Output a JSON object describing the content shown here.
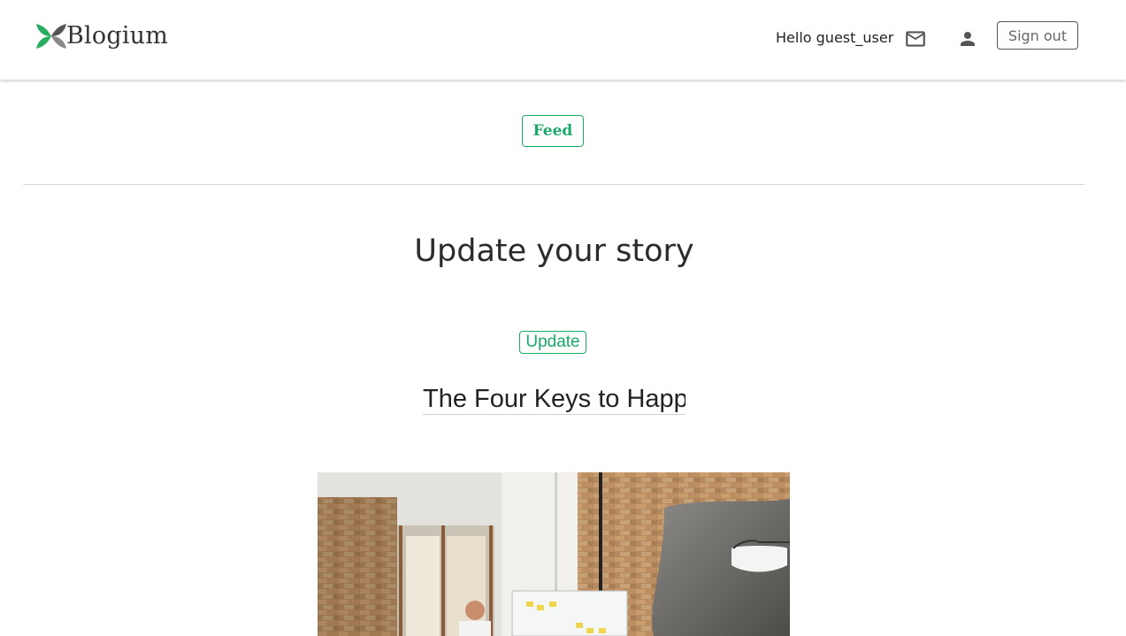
{
  "header": {
    "brand": "Blogium",
    "greeting": "Hello guest_user",
    "icons": {
      "mail": "mail-icon",
      "profile": "person-icon"
    },
    "signout_label": "Sign out"
  },
  "nav": {
    "feed_label": "Feed"
  },
  "main": {
    "heading": "Update your story",
    "update_label": "Update",
    "title_value": "The Four Keys to Happi",
    "image_description_icon": "story-cover-image"
  },
  "colors": {
    "accent": "#1aab68",
    "text": "#333333",
    "divider": "#d9d9d9"
  }
}
